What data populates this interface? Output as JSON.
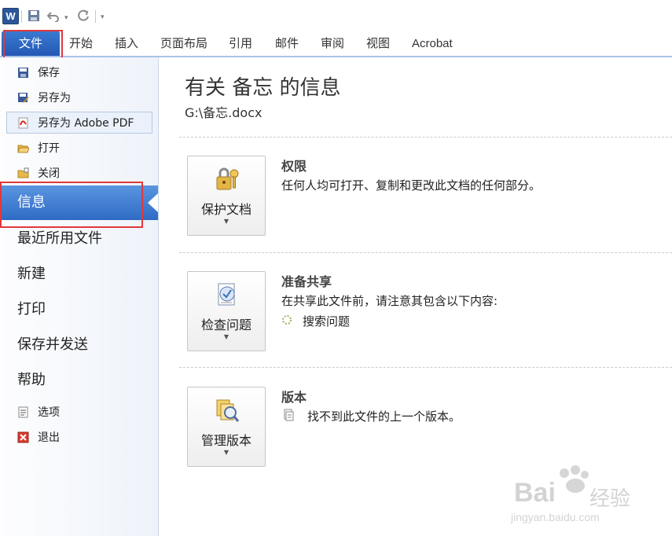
{
  "qat": {
    "app_icon": "W"
  },
  "tabs": [
    "文件",
    "开始",
    "插入",
    "页面布局",
    "引用",
    "邮件",
    "审阅",
    "视图",
    "Acrobat"
  ],
  "left": {
    "commands": [
      "保存",
      "另存为",
      "另存为 Adobe PDF",
      "打开",
      "关闭"
    ],
    "selected": "信息",
    "items": [
      "最近所用文件",
      "新建",
      "打印",
      "保存并发送",
      "帮助"
    ],
    "bottom_commands": [
      "选项",
      "退出"
    ]
  },
  "main": {
    "title": "有关 备忘 的信息",
    "path": "G:\\备忘.docx",
    "sections": [
      {
        "button": "保护文档",
        "title": "权限",
        "text": "任何人均可打开、复制和更改此文档的任何部分。",
        "sub": ""
      },
      {
        "button": "检查问题",
        "title": "准备共享",
        "text": "在共享此文件前，请注意其包含以下内容:",
        "sub": "搜索问题"
      },
      {
        "button": "管理版本",
        "title": "版本",
        "text": "找不到此文件的上一个版本。",
        "sub": ""
      }
    ]
  },
  "watermark": {
    "line1": "Bai",
    "line2": "经验",
    "line3": "jingyan.baidu.com"
  },
  "colors": {
    "accent": "#2f6bc4",
    "highlight_box": "#e0393c"
  }
}
